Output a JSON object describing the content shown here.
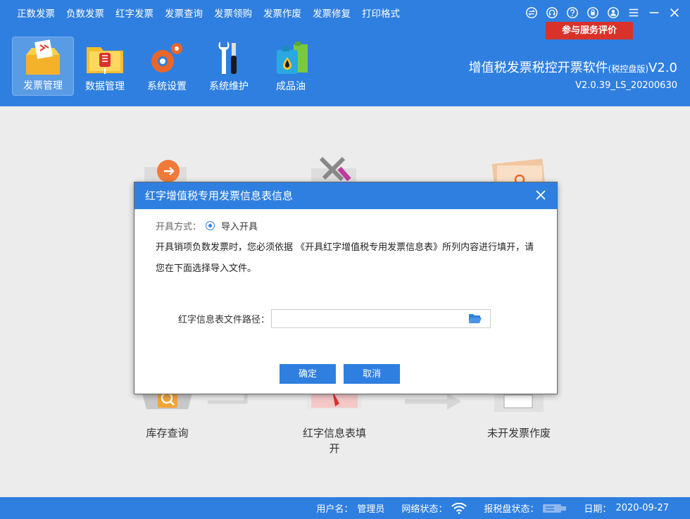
{
  "menu": [
    "正数发票",
    "负数发票",
    "红字发票",
    "发票查询",
    "发票领购",
    "发票作废",
    "发票修复",
    "打印格式"
  ],
  "service_button": "参与服务评价",
  "toolbar": [
    {
      "label": "发票管理",
      "icon": "invoice-box-icon",
      "active": true
    },
    {
      "label": "数据管理",
      "icon": "folder-icon",
      "active": false
    },
    {
      "label": "系统设置",
      "icon": "gear-icon",
      "active": false
    },
    {
      "label": "系统维护",
      "icon": "tools-icon",
      "active": false
    },
    {
      "label": "成品油",
      "icon": "oil-can-icon",
      "active": false
    }
  ],
  "brand": {
    "title": "增值税发票税控开票软件",
    "edition": "(税控盘版)",
    "version_suffix": "V2.0",
    "build": "V2.0.39_LS_20200630"
  },
  "background_items": [
    "库存查询",
    "红字信息表填开",
    "未开发票作废"
  ],
  "dialog": {
    "title": "红字增值税专用发票信息表信息",
    "method_label": "开具方式：",
    "method_value": "导入开具",
    "instruction": "开具销项负数发票时，您必须依据 《开具红字增值税专用发票信息表》所列内容进行填开，请您在下面选择导入文件。",
    "path_label": "红字信息表文件路径：",
    "path_value": "",
    "ok": "确定",
    "cancel": "取消"
  },
  "status": {
    "user_label": "用户名：",
    "user": "管理员",
    "net_label": "网络状态：",
    "disk_label": "报税盘状态：",
    "date_label": "日期：",
    "date": "2020-09-27"
  },
  "colors": {
    "primary": "#2f7fe0",
    "danger": "#d9322a"
  }
}
